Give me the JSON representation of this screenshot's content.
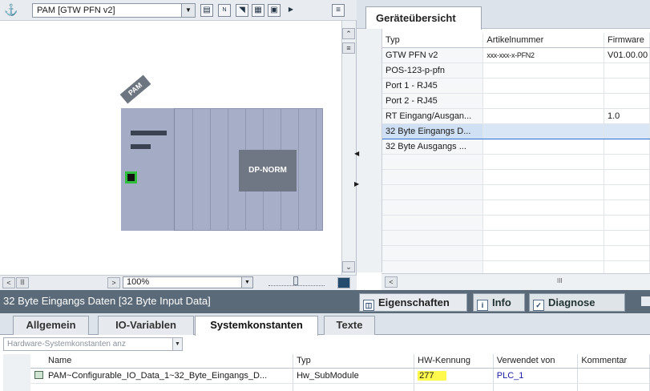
{
  "device_view": {
    "device_select_value": "PAM [GTW PFN v2]",
    "module_tag": "PAM",
    "module_label": "DP-NORM",
    "zoom_value": "100%"
  },
  "device_overview": {
    "tab_title": "Geräteübersicht",
    "columns": [
      "Typ",
      "Artikelnummer",
      "Firmware"
    ],
    "rows": [
      [
        "GTW PFN v2",
        "xxx-xxx-x-PFN2",
        "V01.00.00"
      ],
      [
        "POS-123-p-pfn",
        "",
        ""
      ],
      [
        "Port 1 - RJ45",
        "",
        ""
      ],
      [
        "Port 2 - RJ45",
        "",
        ""
      ],
      [
        "RT Eingang/Ausgan...",
        "",
        "1.0"
      ],
      [
        "32 Byte Eingangs D...",
        "",
        ""
      ],
      [
        "32 Byte Ausgangs ...",
        "",
        ""
      ],
      [
        "",
        "",
        ""
      ],
      [
        "",
        "",
        ""
      ],
      [
        "",
        "",
        ""
      ],
      [
        "",
        "",
        ""
      ],
      [
        "",
        "",
        ""
      ],
      [
        "",
        "",
        ""
      ],
      [
        "",
        "",
        ""
      ],
      [
        "",
        "",
        ""
      ]
    ],
    "selected_row": 5,
    "scroll_indicator": "III"
  },
  "inspector": {
    "title": "32 Byte Eingangs Daten [32 Byte Input Data]",
    "tabs": {
      "eigenschaften": "Eigenschaften",
      "info": "Info",
      "diagnose": "Diagnose"
    },
    "subtabs": {
      "allgemein": "Allgemein",
      "io_variablen": "IO-Variablen",
      "systemkonstanten": "Systemkonstanten",
      "texte": "Texte"
    },
    "filter_placeholder": "Hardware-Systemkonstanten anz",
    "table": {
      "columns": {
        "name": "Name",
        "typ": "Typ",
        "hw_kennung": "HW-Kennung",
        "verwendet_von": "Verwendet von",
        "kommentar": "Kommentar"
      },
      "row": {
        "name": "PAM~Configurable_IO_Data_1~32_Byte_Eingangs_D...",
        "typ": "Hw_SubModule",
        "hw_kennung": "277",
        "verwendet_von": "PLC_1",
        "kommentar": ""
      }
    }
  },
  "colors": {
    "inspector_header": "#5b6a79",
    "selection": "#d9e6f5",
    "highlight": "#fff94d",
    "port_green": "#2fbf3c"
  }
}
